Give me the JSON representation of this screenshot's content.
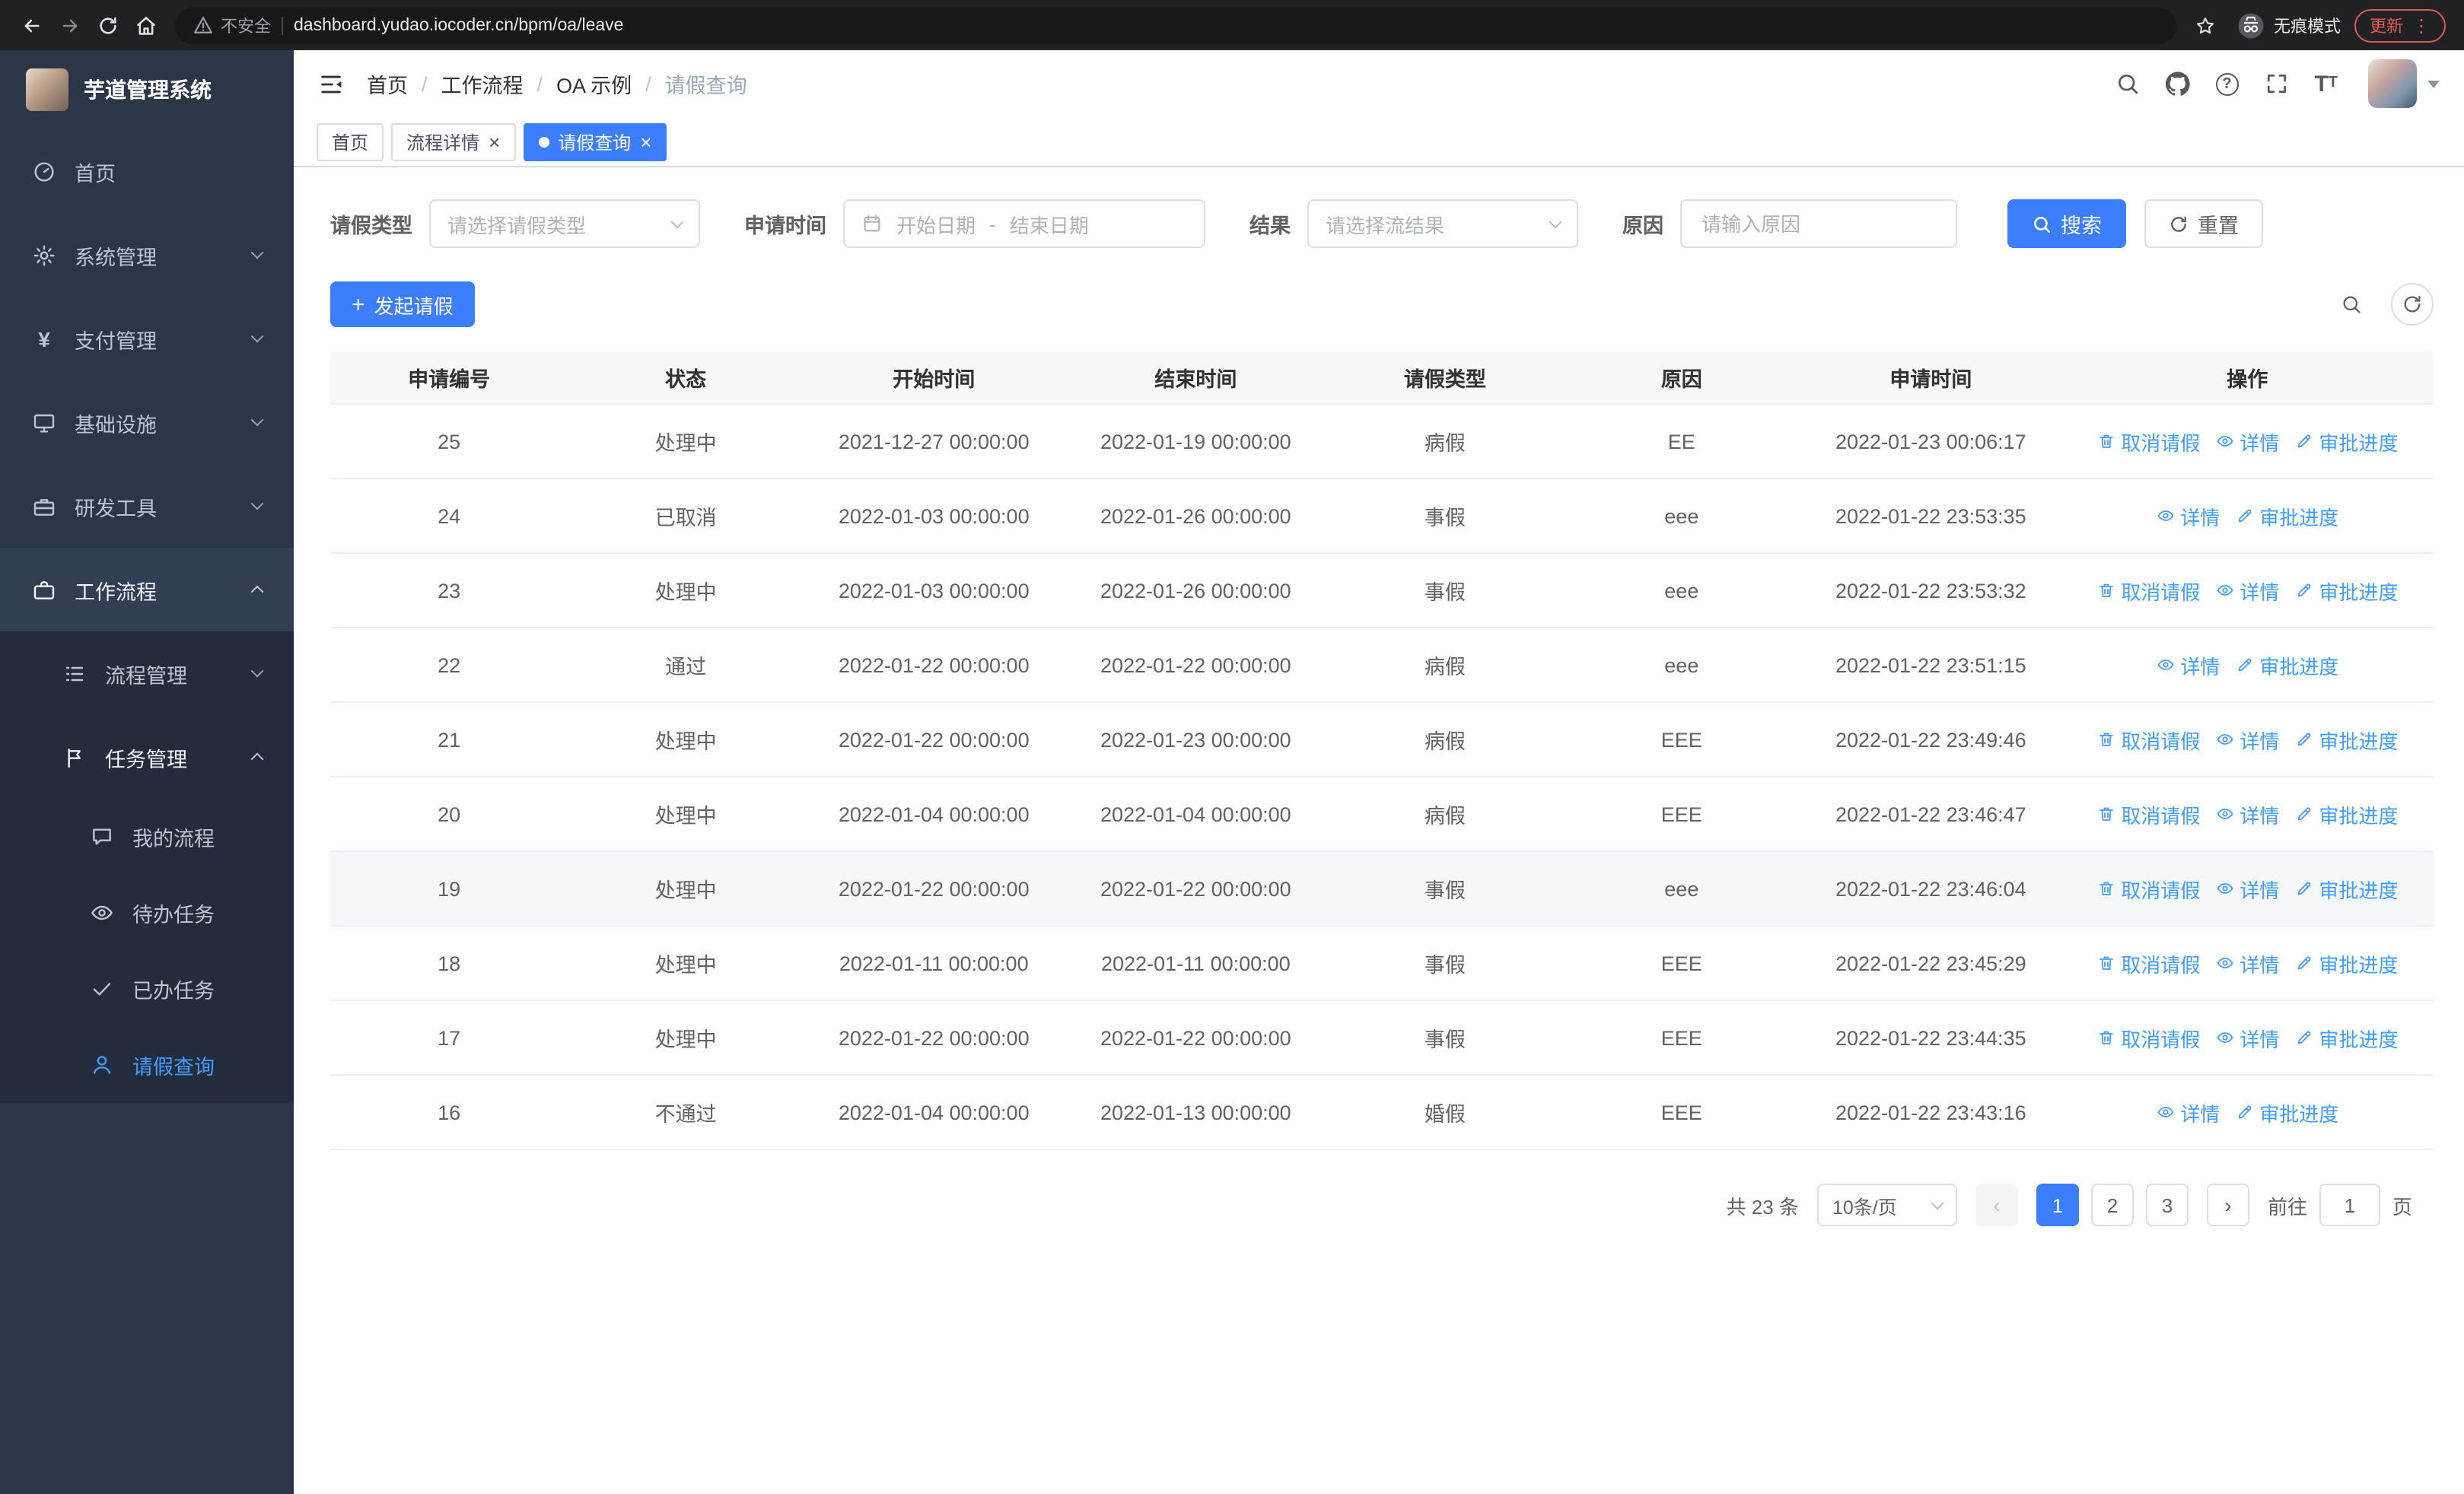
{
  "colors": {
    "primary": "#3d7eff",
    "link": "#409eff",
    "sidebar_bg": "#2b3648",
    "sidebar_sub_bg": "#222c3c",
    "sidebar_active_bg": "#313e53"
  },
  "icons": {
    "close_glyph": "×",
    "breadcrumb_separator": "/",
    "help_glyph": "?",
    "menu_dots_glyph": "⋮",
    "yen_glyph": "¥",
    "plus_glyph": "+",
    "font_large_glyph": "T",
    "font_small_glyph": "T",
    "chevron_left_glyph": "‹",
    "chevron_right_glyph": "›"
  },
  "browser": {
    "security_label": "不安全",
    "url": "dashboard.yudao.iocoder.cn/bpm/oa/leave",
    "incognito_label": "无痕模式",
    "update_label": "更新"
  },
  "sidebar": {
    "app_title": "芋道管理系统",
    "menu": [
      {
        "key": "home",
        "label": "首页",
        "icon": "home-icon",
        "level": 0
      },
      {
        "key": "system",
        "label": "系统管理",
        "icon": "gear-icon",
        "level": 0,
        "chevron": "down"
      },
      {
        "key": "payment",
        "label": "支付管理",
        "icon": "yen-icon",
        "level": 0,
        "chevron": "down"
      },
      {
        "key": "infra",
        "label": "基础设施",
        "icon": "infra-icon",
        "level": 0,
        "chevron": "down"
      },
      {
        "key": "devtools",
        "label": "研发工具",
        "icon": "tools-icon",
        "level": 0,
        "chevron": "down"
      },
      {
        "key": "workflow",
        "label": "工作流程",
        "icon": "workflow-icon",
        "level": 0,
        "chevron": "up",
        "open": true
      },
      {
        "key": "process-mgmt",
        "label": "流程管理",
        "icon": "process-icon",
        "level": 1,
        "chevron": "down"
      },
      {
        "key": "task-mgmt",
        "label": "任务管理",
        "icon": "task-icon",
        "level": 1,
        "chevron": "up",
        "open": true
      },
      {
        "key": "my-process",
        "label": "我的流程",
        "icon": "chat-icon",
        "level": 2
      },
      {
        "key": "todo-task",
        "label": "待办任务",
        "icon": "eye-icon",
        "level": 2
      },
      {
        "key": "done-task",
        "label": "已办任务",
        "icon": "check-icon",
        "level": 2
      },
      {
        "key": "leave-query",
        "label": "请假查询",
        "icon": "user-icon",
        "level": 2,
        "active": true
      }
    ]
  },
  "header": {
    "breadcrumb": [
      "首页",
      "工作流程",
      "OA 示例",
      "请假查询"
    ]
  },
  "tabs": [
    {
      "key": "home",
      "label": "首页",
      "closable": false,
      "active": false
    },
    {
      "key": "process-detail",
      "label": "流程详情",
      "closable": true,
      "active": false
    },
    {
      "key": "leave-query",
      "label": "请假查询",
      "closable": true,
      "active": true
    }
  ],
  "filters": {
    "leave_type_label": "请假类型",
    "leave_type_placeholder": "请选择请假类型",
    "apply_time_label": "申请时间",
    "start_date_placeholder": "开始日期",
    "date_separator": "-",
    "end_date_placeholder": "结束日期",
    "result_label": "结果",
    "result_placeholder": "请选择流结果",
    "reason_label": "原因",
    "reason_placeholder": "请输入原因",
    "search_button": "搜索",
    "reset_button": "重置"
  },
  "toolbar": {
    "create_button": "发起请假"
  },
  "table": {
    "headers": [
      "申请编号",
      "状态",
      "开始时间",
      "结束时间",
      "请假类型",
      "原因",
      "申请时间",
      "操作"
    ],
    "actions": {
      "cancel": "取消请假",
      "detail": "详情",
      "progress": "审批进度"
    },
    "rows": [
      {
        "id": "25",
        "status": "处理中",
        "start_time": "2021-12-27 00:00:00",
        "end_time": "2022-01-19 00:00:00",
        "leave_type": "病假",
        "reason": "EE",
        "apply_time": "2022-01-23 00:06:17",
        "ops": [
          "cancel",
          "detail",
          "progress"
        ]
      },
      {
        "id": "24",
        "status": "已取消",
        "start_time": "2022-01-03 00:00:00",
        "end_time": "2022-01-26 00:00:00",
        "leave_type": "事假",
        "reason": "eee",
        "apply_time": "2022-01-22 23:53:35",
        "ops": [
          "detail",
          "progress"
        ]
      },
      {
        "id": "23",
        "status": "处理中",
        "start_time": "2022-01-03 00:00:00",
        "end_time": "2022-01-26 00:00:00",
        "leave_type": "事假",
        "reason": "eee",
        "apply_time": "2022-01-22 23:53:32",
        "ops": [
          "cancel",
          "detail",
          "progress"
        ]
      },
      {
        "id": "22",
        "status": "通过",
        "start_time": "2022-01-22 00:00:00",
        "end_time": "2022-01-22 00:00:00",
        "leave_type": "病假",
        "reason": "eee",
        "apply_time": "2022-01-22 23:51:15",
        "ops": [
          "detail",
          "progress"
        ]
      },
      {
        "id": "21",
        "status": "处理中",
        "start_time": "2022-01-22 00:00:00",
        "end_time": "2022-01-23 00:00:00",
        "leave_type": "病假",
        "reason": "EEE",
        "apply_time": "2022-01-22 23:49:46",
        "ops": [
          "cancel",
          "detail",
          "progress"
        ]
      },
      {
        "id": "20",
        "status": "处理中",
        "start_time": "2022-01-04 00:00:00",
        "end_time": "2022-01-04 00:00:00",
        "leave_type": "病假",
        "reason": "EEE",
        "apply_time": "2022-01-22 23:46:47",
        "ops": [
          "cancel",
          "detail",
          "progress"
        ]
      },
      {
        "id": "19",
        "status": "处理中",
        "start_time": "2022-01-22 00:00:00",
        "end_time": "2022-01-22 00:00:00",
        "leave_type": "事假",
        "reason": "eee",
        "apply_time": "2022-01-22 23:46:04",
        "ops": [
          "cancel",
          "detail",
          "progress"
        ],
        "highlighted": true
      },
      {
        "id": "18",
        "status": "处理中",
        "start_time": "2022-01-11 00:00:00",
        "end_time": "2022-01-11 00:00:00",
        "leave_type": "事假",
        "reason": "EEE",
        "apply_time": "2022-01-22 23:45:29",
        "ops": [
          "cancel",
          "detail",
          "progress"
        ]
      },
      {
        "id": "17",
        "status": "处理中",
        "start_time": "2022-01-22 00:00:00",
        "end_time": "2022-01-22 00:00:00",
        "leave_type": "事假",
        "reason": "EEE",
        "apply_time": "2022-01-22 23:44:35",
        "ops": [
          "cancel",
          "detail",
          "progress"
        ]
      },
      {
        "id": "16",
        "status": "不通过",
        "start_time": "2022-01-04 00:00:00",
        "end_time": "2022-01-13 00:00:00",
        "leave_type": "婚假",
        "reason": "EEE",
        "apply_time": "2022-01-22 23:43:16",
        "ops": [
          "detail",
          "progress"
        ]
      }
    ]
  },
  "pagination": {
    "total": "共 23 条",
    "page_size": "10条/页",
    "pages": [
      "1",
      "2",
      "3"
    ],
    "current_page": "1",
    "goto_label": "前往",
    "goto_value": "1",
    "goto_suffix": "页"
  }
}
